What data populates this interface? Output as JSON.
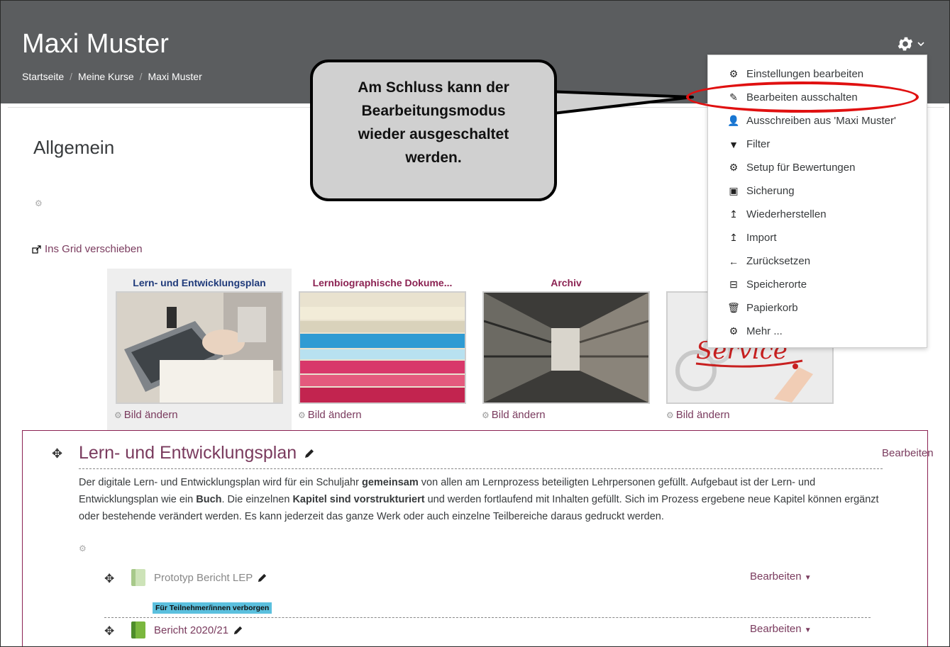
{
  "header": {
    "title": "Maxi Muster",
    "breadcrumb": [
      "Startseite",
      "Meine Kurse",
      "Maxi Muster"
    ]
  },
  "section0": {
    "title": "Allgemein",
    "move_to_grid": "Ins Grid verschieben"
  },
  "tiles": [
    {
      "title": "Lern- und Entwicklungsplan",
      "change": "Bild ändern"
    },
    {
      "title": "Lernbiographische Dokume...",
      "change": "Bild ändern"
    },
    {
      "title": "Archiv",
      "change": "Bild ändern"
    },
    {
      "title": "",
      "change": "Bild ändern",
      "image_text": "Service"
    }
  ],
  "section1": {
    "title": "Lern- und Entwicklungsplan",
    "edit": "Bearbeiten",
    "summary_parts": [
      "Der digitale Lern- und Entwicklungsplan wird für ein Schuljahr ",
      "gemeinsam",
      " von allen am Lernprozess beteiligten Lehrpersonen gefüllt. Aufgebaut ist der Lern- und Entwicklungsplan wie ein ",
      "Buch",
      ". Die einzelnen ",
      "Kapitel sind vorstrukturiert",
      " und werden fortlaufend mit Inhalten gefüllt. Sich im Prozess ergebene neue Kapitel können ergänzt oder bestehende verändert werden. Es kann jederzeit das ganze Werk oder auch einzelne Teilbereiche daraus gedruckt werden."
    ],
    "activities": [
      {
        "name": "Prototyp Bericht LEP",
        "edit": "Bearbeiten",
        "badge": "Für Teilnehmer/innen verborgen"
      },
      {
        "name": "Bericht 2020/21",
        "edit": "Bearbeiten"
      }
    ]
  },
  "menu": {
    "items": [
      {
        "label": "Einstellungen bearbeiten",
        "icon": "gear-icon"
      },
      {
        "label": "Bearbeiten ausschalten",
        "icon": "pencil-icon"
      },
      {
        "label": "Ausschreiben aus 'Maxi Muster'",
        "icon": "user-icon"
      },
      {
        "label": "Filter",
        "icon": "filter-icon"
      },
      {
        "label": "Setup für Bewertungen",
        "icon": "gear-icon"
      },
      {
        "label": "Sicherung",
        "icon": "file-archive-icon"
      },
      {
        "label": "Wiederherstellen",
        "icon": "upload-icon"
      },
      {
        "label": "Import",
        "icon": "upload-icon"
      },
      {
        "label": "Zurücksetzen",
        "icon": "arrow-left-icon"
      },
      {
        "label": "Speicherorte",
        "icon": "storage-icon"
      },
      {
        "label": "Papierkorb",
        "icon": "trash-icon"
      },
      {
        "label": "Mehr ...",
        "icon": "gear-icon"
      }
    ]
  },
  "callout": {
    "lines": [
      "Am Schluss kann der",
      "Bearbeitungsmodus",
      "wieder ausgeschaltet",
      "werden."
    ]
  },
  "colors": {
    "header": "#5b5d5f",
    "accent": "#7a3b5e",
    "highlight_ellipse": "#e01010",
    "badge": "#5bc0de"
  }
}
